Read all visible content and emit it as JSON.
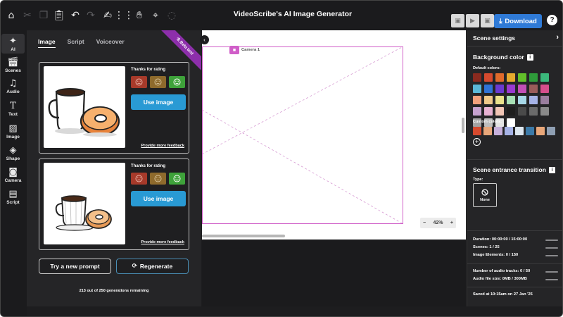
{
  "app": {
    "title": "VideoScribe's AI Image Generator"
  },
  "toolbar": {
    "icons": [
      "home-icon",
      "cut-icon",
      "copy-icon",
      "paste-icon",
      "undo-icon",
      "redo-icon",
      "draw-icon",
      "grid-icon",
      "hand-icon",
      "pin-off-icon",
      "hide-icon"
    ],
    "download_label": "Download",
    "help_label": "?"
  },
  "rail": {
    "items": [
      {
        "label": "AI",
        "icon": "ai-sparkle-icon"
      },
      {
        "label": "Scenes",
        "icon": "scenes-icon"
      },
      {
        "label": "Audio",
        "icon": "audio-icon"
      },
      {
        "label": "Text",
        "icon": "text-icon"
      },
      {
        "label": "Image",
        "icon": "image-icon"
      },
      {
        "label": "Shape",
        "icon": "shape-icon"
      },
      {
        "label": "Camera",
        "icon": "camera-icon"
      },
      {
        "label": "Script",
        "icon": "script-icon"
      }
    ]
  },
  "ai_panel": {
    "tabs": [
      "Image",
      "Script",
      "Voiceover"
    ],
    "active_tab": "Image",
    "beta_badge": "Beta test",
    "cards": [
      {
        "rating_label": "Thanks for rating",
        "use_label": "Use image",
        "feedback_label": "Provide more feedback"
      },
      {
        "rating_label": "Thanks for rating",
        "use_label": "Use image",
        "feedback_label": "Provide more feedback"
      }
    ],
    "new_prompt_label": "Try a new prompt",
    "regenerate_label": "Regenerate",
    "remaining_text": "213 out of 250 generations remaining"
  },
  "canvas": {
    "camera_label": "Camera 1",
    "zoom_level": "42%",
    "zoom_out": "−",
    "zoom_in": "+"
  },
  "scene_settings": {
    "title": "Scene settings",
    "background_title": "Background color",
    "default_colors_label": "Default colors:",
    "default_colors": [
      "#8a2a1f",
      "#d64a2e",
      "#e06a2b",
      "#e5a92d",
      "#62c02a",
      "#2e9b3a",
      "#3bb87b",
      "#5ab8d8",
      "#2f73d6",
      "#6b3ad1",
      "#9b3ad1",
      "#c34fb7",
      "#9a5c5a",
      "#d64e8c",
      "#f0a07c",
      "#efc98a",
      "#eae28c",
      "#a8e0b6",
      "#a7d8e8",
      "#a6b3e6",
      "#9a7e9e",
      "#c6a2cf",
      "#e8b2d3",
      "#f2c6b6",
      "#1e1e1e",
      "#4a4a4a",
      "#6a6a6a",
      "#8a8a8a",
      "#a2a2a2",
      "#bdbdbd",
      "#e3e3e3",
      "#ffffff"
    ],
    "custom_colors_label": "Custom colors:",
    "custom_colors": [
      "#d64a2e",
      "#e8a77a",
      "#c6b0db",
      "#a6b3e6",
      "#dde7ef",
      "#3c7aa8",
      "#e8a77a",
      "#8f9fb3"
    ],
    "transition_title": "Scene entrance transition",
    "type_label": "Type:",
    "none_label": "None",
    "stats": [
      "Duration: 00:00:00 / 15:00:00",
      "Scenes: 1 / 25",
      "Image Elements: 0 / 150",
      "Number of audio tracks: 0 / 50",
      "Audio file size: 0MB / 300MB",
      "Saved at 10:15am on 27 Jan '25"
    ]
  },
  "colors": {
    "accent": "#2f7ad6",
    "use_button": "#299ad4",
    "camera": "#d05ec8",
    "beta": "#8d2fab"
  }
}
